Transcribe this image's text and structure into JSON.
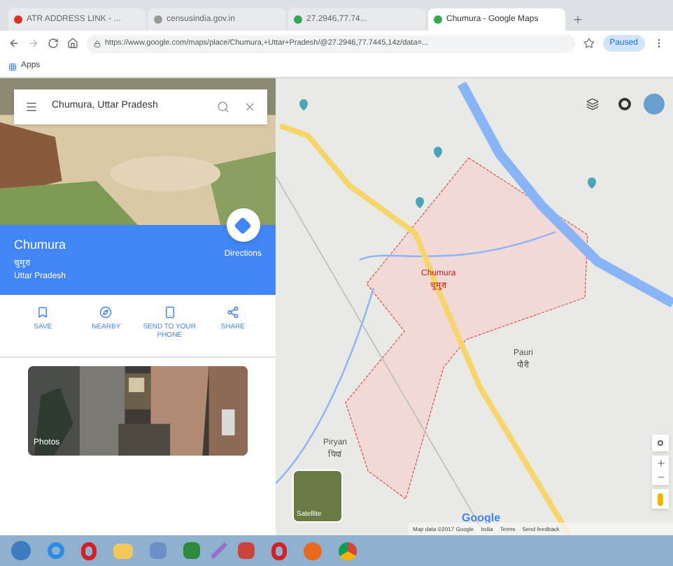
{
  "browser": {
    "tabs": [
      {
        "title": "ATR ADDRESS LINK - ...",
        "selected": false
      },
      {
        "title": "censusindia.gov.in",
        "selected": false
      },
      {
        "title": "27.2946,77.74...",
        "selected": false
      },
      {
        "title": "Chumura - Google Maps",
        "selected": true
      }
    ],
    "url": "https://www.google.com/maps/place/Chumura,+Uttar+Pradesh/@27.2946,77.7445,14z/data=...",
    "profile": "Paused",
    "bookmarks": [
      "Apps"
    ]
  },
  "sidebar": {
    "search": {
      "value": "Chumura, Uttar Pradesh"
    },
    "place": {
      "name": "Chumura",
      "native_name": "चुमुरा",
      "region": "Uttar Pradesh"
    },
    "directions": "Directions",
    "actions": [
      {
        "kind": "save",
        "label": "SAVE"
      },
      {
        "kind": "nearby",
        "label": "NEARBY"
      },
      {
        "kind": "phone",
        "label": "SEND TO YOUR PHONE"
      },
      {
        "kind": "share",
        "label": "SHARE"
      }
    ],
    "photos_label": "Photos"
  },
  "map": {
    "labels": [
      {
        "kind": "place",
        "text": "Chumura",
        "native": "चुमुरा"
      },
      {
        "kind": "village",
        "text": "Pauri",
        "native": "पौरी"
      },
      {
        "kind": "village",
        "text": "Piryan",
        "native": "पियां"
      }
    ],
    "satellite_label": "Satellite",
    "logo": "Google",
    "footer": [
      "Map data ©2017 Google",
      "India",
      "Terms",
      "Send feedback"
    ]
  }
}
